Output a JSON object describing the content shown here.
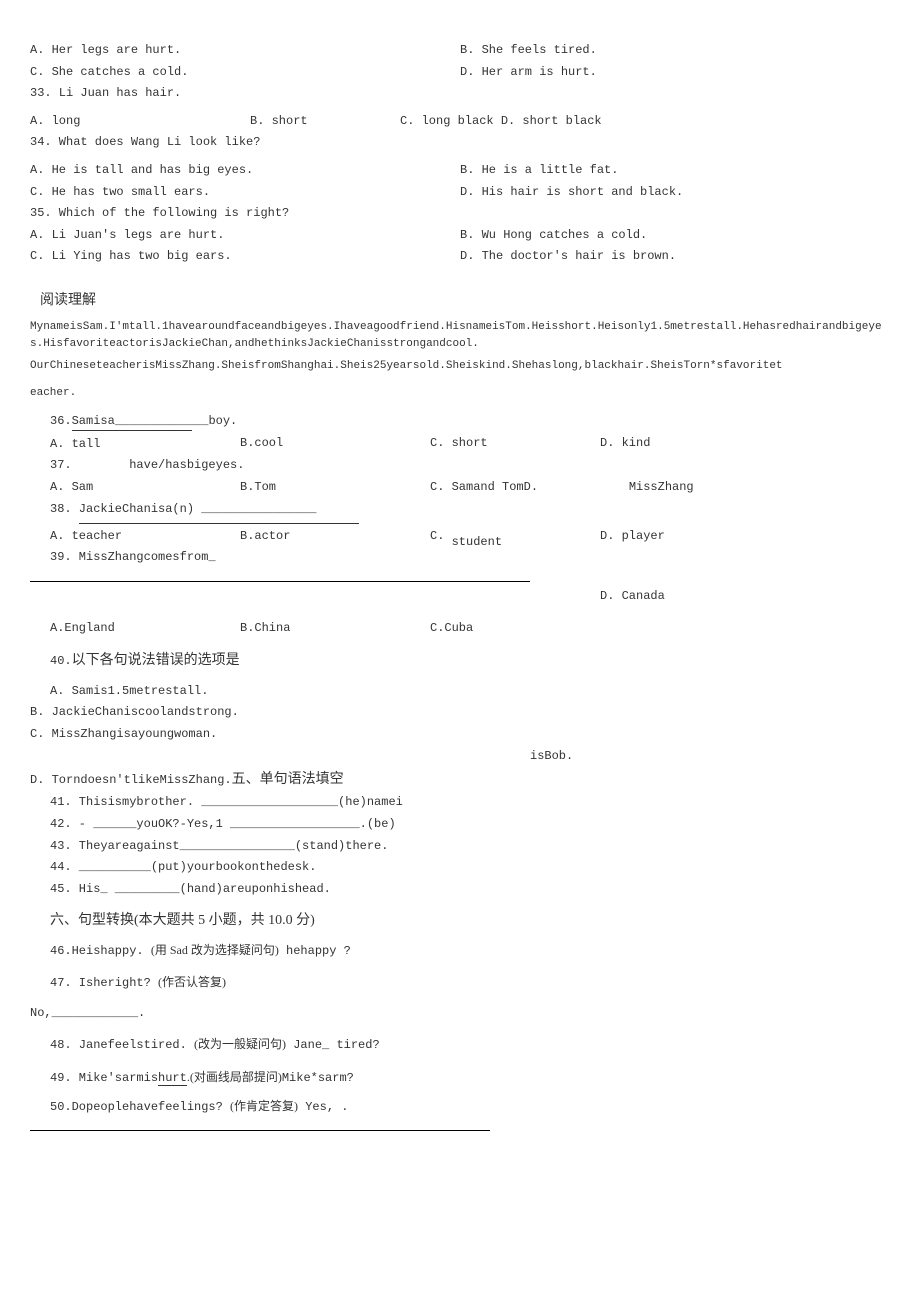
{
  "q32": {
    "a": "A. Her legs are hurt.",
    "b": "B.  She feels tired.",
    "c": "C. She catches a cold.",
    "d": "D. Her arm is hurt."
  },
  "q33": {
    "stem": "33. Li Juan has  hair.",
    "a": "A. long",
    "b": "B. short",
    "c": "C.  long black D. short black"
  },
  "q34": {
    "stem": "34. What   does Wang Li look like?",
    "a": "A. He is   tall and has big eyes.",
    "b": "B.  He is a little fat.",
    "c": "C. He has  two small ears.",
    "d": "D. His hair is short and black."
  },
  "q35": {
    "stem": "35. Which of the following is right?",
    "a": "A.  Li Juan's legs are hurt.",
    "b": "B. Wu Hong catches a cold.",
    "c": "C. Li Ying has two big ears.",
    "d": "D. The doctor's hair is brown."
  },
  "reading": {
    "title": "阅读理解",
    "passage_line1": "MynameisSam.I'mtall.1havearoundfaceandbigeyes.Ihaveagoodfriend.HisnameisTom.Heisshort.Heisonly1.5metrestall.Hehasredhairandbigeyes.HisfavoriteactorisJackieChan,andhethinksJackieChanisstrongandcool.",
    "passage_line2": "OurChineseteacherisMissZhang.SheisfromShanghai.Sheis25yearsold.Sheiskind.Shehaslong,blackhair.SheisTorn*sfavoritet",
    "passage_line3": "eacher."
  },
  "q36": {
    "stem": "36.Samisa",
    "stem_suffix": "boy.",
    "a": "tall",
    "b": "B.cool",
    "c": "short",
    "d": "kind"
  },
  "q37": {
    "stem": "37.",
    "suffix": "have/hasbigeyes.",
    "a": "Sam",
    "b": "B.Tom",
    "c": "Samand   TomD.",
    "d": "MissZhang"
  },
  "q38": {
    "stem": "38. JackieChanisa(n)",
    "a": "teacher",
    "b": "B.actor",
    "c": "student",
    "d": "player"
  },
  "q39": {
    "stem": "39. MissZhangcomesfrom_",
    "a": "A.England",
    "b": "B.China",
    "c": "C.Cuba",
    "d": "Canada"
  },
  "q40": {
    "stem": "40.以下各句说法错误的选项是",
    "a": "A.  Samis1.5metrestall.",
    "b": "B.  JackieChaniscoolandstrong.",
    "c": "C.  MissZhangisayoungwoman.",
    "d_prefix": "D.  Torndoesn'tlikeMissZhang.",
    "d_suffix": "五、单句语法填空",
    "float": "isBob."
  },
  "q41": "41.  Thisismybrother. ___________________(he)namei",
  "q42": "42.  - ______youOK?-Yes,1 __________________.(be)",
  "q43": "43.  Theyareagainst________________(stand)there.",
  "q44": "44.  __________(put)yourbookonthedesk.",
  "q45": "45.  His_ _________(hand)areuponhishead.",
  "section6": "六、句型转换(本大题共 5 小题，共 10.0 分)",
  "q46": {
    "pre": "46.Heishappy.",
    "mid": "(用 Sad 改为选择疑问句)",
    "post": " hehappy ?"
  },
  "q47": {
    "pre": "47.  Isheright?",
    "post": "(作否认答复)"
  },
  "q47_ans": "No,____________.",
  "q48": {
    "pre": "48.  Janefeelstired.",
    "mid": "(改为一般疑问句)",
    "post": "Jane_    tired?"
  },
  "q49": {
    "pre": "49.  Mike'sarmis",
    "under": "hurt",
    "mid": ".(对画线局部提问)",
    "post": "Mike*sarm?"
  },
  "q50": {
    "pre": "50.Dopeoplehavefeelings?",
    "mid": "(作肯定答复)",
    "post": "Yes,    ."
  }
}
